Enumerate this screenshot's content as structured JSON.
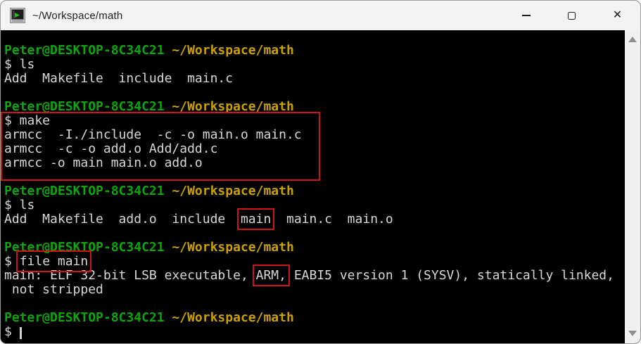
{
  "window": {
    "title": "~/Workspace/math",
    "icons": {
      "app": "terminal-icon",
      "minimize": "minimize-icon",
      "maximize": "maximize-icon",
      "close": "✕",
      "scroll_up": "up-arrow-icon",
      "scroll_down": "down-arrow-icon"
    }
  },
  "colors": {
    "term-bg": "#000000",
    "fg": "#d8d8d8",
    "green": "#0ca50c",
    "gold": "#c9a000",
    "red": "#cb1616",
    "titlebar-bg": "#f3f3f3",
    "scroll-bg": "#f0f0f0"
  },
  "prompt": {
    "user_host": "Peter@DESKTOP-8C34C21",
    "cwd": "~/Workspace/math"
  },
  "terminal": {
    "lines": [
      {
        "segments": [
          {
            "text": "Peter@DESKTOP-8C34C21",
            "style": "user"
          },
          {
            "text": " ~/Workspace/math",
            "style": "path"
          }
        ]
      },
      {
        "segments": [
          {
            "text": "$ ls",
            "style": "plain"
          }
        ]
      },
      {
        "segments": [
          {
            "text": "Add  Makefile  include  main.c",
            "style": "plain"
          }
        ]
      },
      {
        "segments": []
      },
      {
        "segments": [
          {
            "text": "Peter@DESKTOP-8C34C21",
            "style": "user"
          },
          {
            "text": " ~/Workspace/math",
            "style": "path"
          }
        ]
      },
      {
        "segments": [
          {
            "text": "$ make",
            "style": "plain"
          }
        ]
      },
      {
        "segments": [
          {
            "text": "armcc  -I./include  -c -o main.o main.c",
            "style": "plain"
          }
        ]
      },
      {
        "segments": [
          {
            "text": "armcc  -c -o add.o Add/add.c",
            "style": "plain"
          }
        ]
      },
      {
        "segments": [
          {
            "text": "armcc -o main main.o add.o",
            "style": "plain"
          }
        ]
      },
      {
        "segments": []
      },
      {
        "segments": [
          {
            "text": "Peter@DESKTOP-8C34C21",
            "style": "user"
          },
          {
            "text": " ~/Workspace/math",
            "style": "path"
          }
        ]
      },
      {
        "segments": [
          {
            "text": "$ ls",
            "style": "plain"
          }
        ]
      },
      {
        "segments": [
          {
            "text": "Add  Makefile  add.o  include  ",
            "style": "plain"
          },
          {
            "text": "main",
            "style": "boxed"
          },
          {
            "text": "  main.c  main.o",
            "style": "plain"
          }
        ]
      },
      {
        "segments": []
      },
      {
        "segments": [
          {
            "text": "Peter@DESKTOP-8C34C21",
            "style": "user"
          },
          {
            "text": " ~/Workspace/math",
            "style": "path"
          }
        ]
      },
      {
        "segments": [
          {
            "text": "$ ",
            "style": "plain"
          },
          {
            "text": "file main",
            "style": "boxed"
          }
        ]
      },
      {
        "segments": [
          {
            "text": "main: ELF 32-bit LSB executable, ",
            "style": "plain"
          },
          {
            "text": "ARM,",
            "style": "boxed"
          },
          {
            "text": " EABI5 version 1 (SYSV), statically linked,",
            "style": "plain"
          }
        ]
      },
      {
        "segments": [
          {
            "text": " not stripped",
            "style": "plain"
          }
        ]
      },
      {
        "segments": []
      },
      {
        "segments": [
          {
            "text": "Peter@DESKTOP-8C34C21",
            "style": "user"
          },
          {
            "text": " ~/Workspace/math",
            "style": "path"
          }
        ]
      },
      {
        "segments": [
          {
            "text": "$ ",
            "style": "plain"
          }
        ],
        "cursor": true
      }
    ]
  },
  "highlights": {
    "make_block_lines": [
      "$ make",
      "armcc  -I./include  -c -o main.o main.c",
      "armcc  -c -o add.o Add/add.c",
      "armcc -o main main.o add.o"
    ],
    "boxed_words": [
      "main",
      "file main",
      "ARM,"
    ]
  }
}
